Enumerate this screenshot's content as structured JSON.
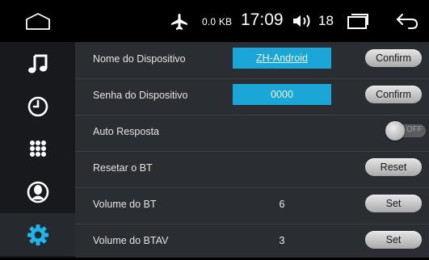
{
  "statusbar": {
    "net_speed": "0.0 KB",
    "clock": "17:09",
    "volume_level": "18"
  },
  "sidebar": {
    "items": [
      {
        "icon": "music-note-icon"
      },
      {
        "icon": "clock-icon"
      },
      {
        "icon": "keypad-icon"
      },
      {
        "icon": "contact-icon"
      },
      {
        "icon": "settings-gear-icon",
        "active": true
      }
    ]
  },
  "settings": {
    "rows": [
      {
        "label": "Nome do Dispositivo",
        "value": "ZH-Android",
        "button": "Confirm"
      },
      {
        "label": "Senha do Dispositivo",
        "value": "0000",
        "button": "Confirm"
      },
      {
        "label": "Auto Resposta",
        "toggle_state": "OFF"
      },
      {
        "label": "Resetar o BT",
        "button": "Reset"
      },
      {
        "label": "Volume do BT",
        "value": "6",
        "button": "Set"
      },
      {
        "label": "Volume do BTAV",
        "value": "3",
        "button": "Set"
      }
    ]
  },
  "colors": {
    "accent": "#1aa6d6",
    "sidebar_bg": "#17191c",
    "content_bg": "#2a2d31",
    "active_icon": "#1fb6ea"
  }
}
